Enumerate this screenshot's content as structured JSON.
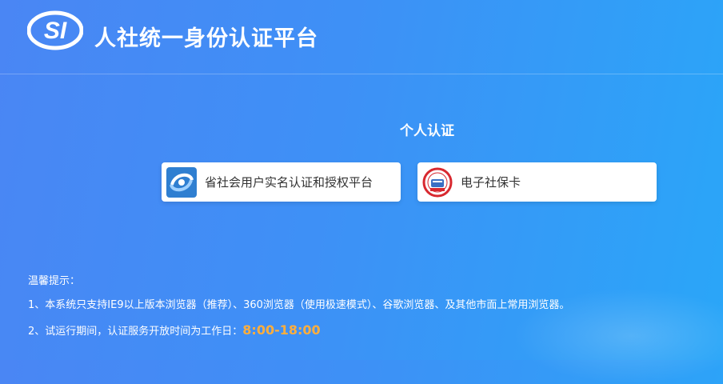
{
  "header": {
    "logo_text": "SI",
    "title": "人社统一身份认证平台"
  },
  "main": {
    "section_title": "个人认证",
    "options": [
      {
        "label": "省社会用户实名认证和授权平台",
        "icon": "provincial-auth-logo-icon"
      },
      {
        "label": "电子社保卡",
        "icon": "e-social-card-seal-icon"
      }
    ]
  },
  "tips": {
    "heading": "温馨提示：",
    "line1": "1、本系统只支持IE9以上版本浏览器（推荐）、360浏览器（使用极速模式）、谷歌浏览器、及其他市面上常用浏览器。",
    "line2_prefix": "2、试运行期间，认证服务开放时间为工作日：",
    "line2_hours": "8:00-18:00"
  },
  "colors": {
    "accent_hours": "#ffae3d",
    "card_icon_blue": "#2f7fd1",
    "seal_red": "#d8282f"
  }
}
